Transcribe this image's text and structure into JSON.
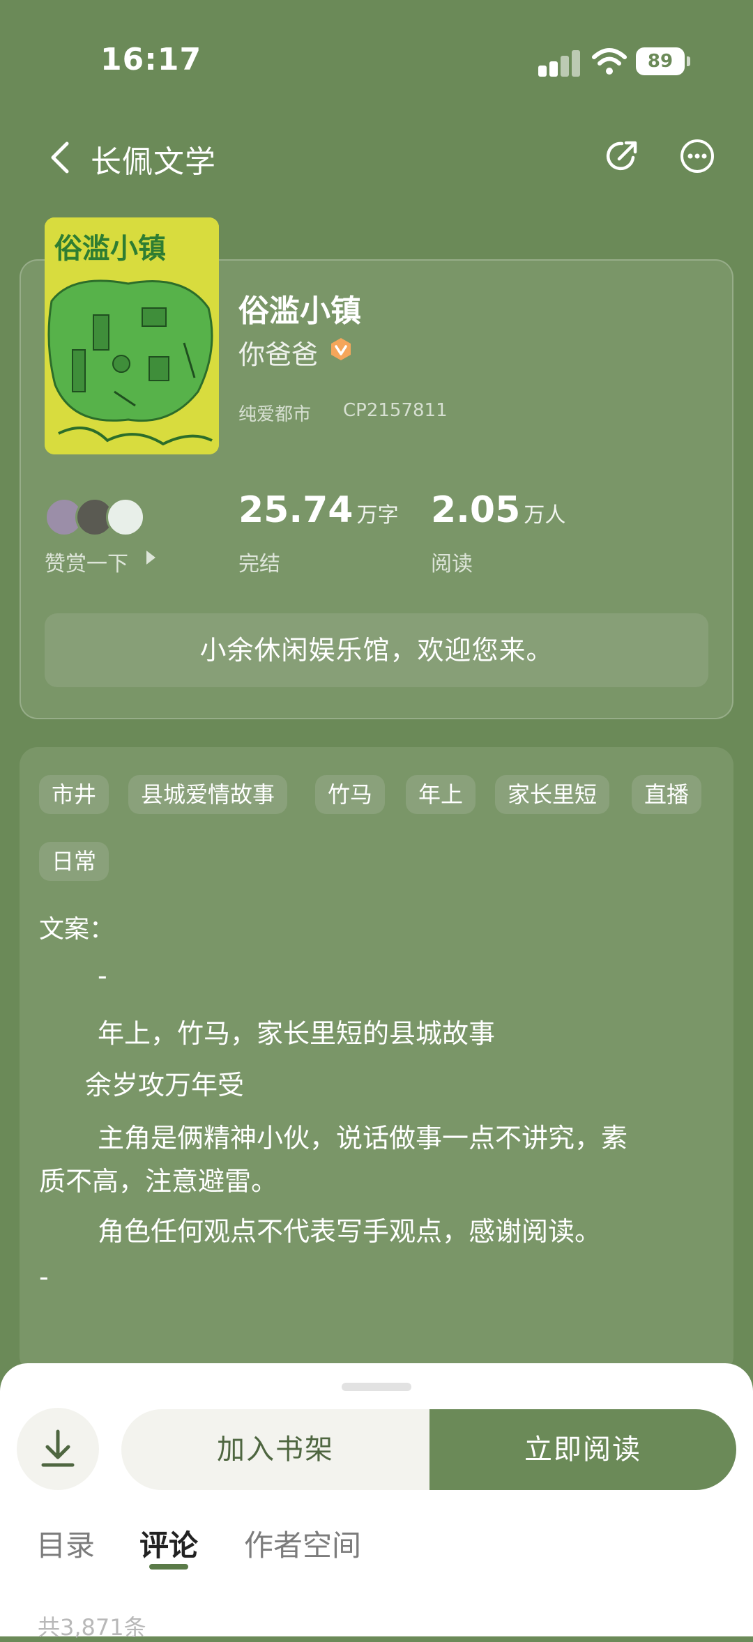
{
  "status_bar": {
    "time": "16:17",
    "battery": "89"
  },
  "nav": {
    "title": "长佩文学"
  },
  "book": {
    "title": "俗滥小镇",
    "author": "你爸爸",
    "category": "纯爱都市",
    "cp_id": "CP2157811",
    "cover_title": "俗滥小镇",
    "reward_label": "赞赏一下",
    "word_count": {
      "value": "25.74",
      "unit": "万字",
      "label": "完结"
    },
    "readers": {
      "value": "2.05",
      "unit": "万人",
      "label": "阅读"
    },
    "welcome": "小余休闲娱乐馆，欢迎您来。"
  },
  "tags": [
    "市井",
    "县城爱情故事",
    "竹马",
    "年上",
    "家长里短",
    "直播",
    "日常"
  ],
  "description": {
    "heading": "文案：",
    "lines": [
      "-",
      "年上，竹马，家长里短的县城故事",
      "余岁攻万年受",
      "主角是俩精神小伙，说话做事一点不讲究，素",
      "质不高，注意避雷。",
      "角色任何观点不代表写手观点，感谢阅读。",
      "-"
    ]
  },
  "actions": {
    "add_shelf": "加入书架",
    "read_now": "立即阅读"
  },
  "tabs": [
    {
      "label": "目录",
      "active": false
    },
    {
      "label": "评论",
      "active": true
    },
    {
      "label": "作者空间",
      "active": false
    }
  ],
  "comments_total": "共3,871条",
  "colors": {
    "background": "#6b8a58",
    "card": "#7a9668",
    "accent": "#6b8a58"
  }
}
